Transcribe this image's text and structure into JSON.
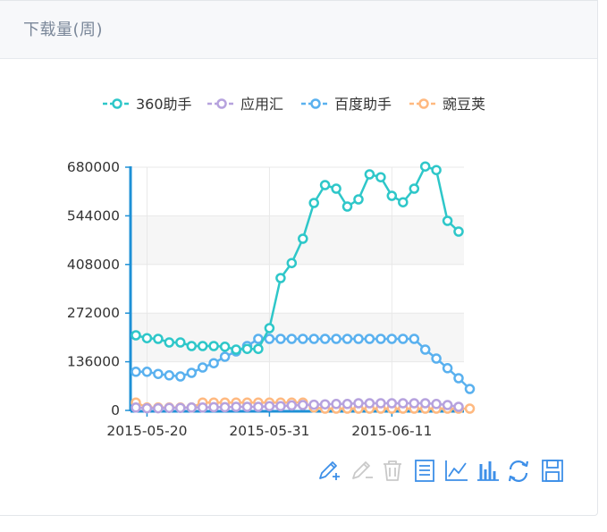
{
  "panel": {
    "title": "下载量(周)"
  },
  "chart_data": {
    "type": "line",
    "title": "",
    "xlabel": "",
    "ylabel": "",
    "ylim": [
      0,
      680000
    ],
    "y_ticks": [
      "0",
      "136000",
      "272000",
      "408000",
      "544000",
      "680000"
    ],
    "x_tick_labels": [
      "2015-05-20",
      "2015-05-31",
      "2015-06-11"
    ],
    "x": [
      "2015-05-19",
      "2015-05-20",
      "2015-05-21",
      "2015-05-22",
      "2015-05-23",
      "2015-05-24",
      "2015-05-25",
      "2015-05-26",
      "2015-05-27",
      "2015-05-28",
      "2015-05-29",
      "2015-05-30",
      "2015-05-31",
      "2015-06-01",
      "2015-06-02",
      "2015-06-03",
      "2015-06-04",
      "2015-06-05",
      "2015-06-06",
      "2015-06-07",
      "2015-06-08",
      "2015-06-09",
      "2015-06-10",
      "2015-06-11",
      "2015-06-12",
      "2015-06-13",
      "2015-06-14",
      "2015-06-15",
      "2015-06-16",
      "2015-06-17",
      "2015-06-18"
    ],
    "grid": true,
    "legend_position": "top-center",
    "series": [
      {
        "name": "360助手",
        "color": "#2ec7c9",
        "values": [
          210000,
          202000,
          200000,
          190000,
          190000,
          180000,
          180000,
          180000,
          178000,
          170000,
          172000,
          172000,
          230000,
          370000,
          412000,
          480000,
          580000,
          630000,
          620000,
          570000,
          590000,
          660000,
          652000,
          600000,
          582000,
          620000,
          682000,
          672000,
          530000,
          500000
        ]
      },
      {
        "name": "应用汇",
        "color": "#b6a2de",
        "values": [
          8000,
          6000,
          6000,
          7000,
          7000,
          8000,
          8000,
          9000,
          9000,
          10000,
          10000,
          10000,
          12000,
          12000,
          14000,
          15000,
          16000,
          17000,
          18000,
          18000,
          20000,
          20000,
          20000,
          20000,
          20000,
          20000,
          20000,
          18000,
          15000,
          10000
        ]
      },
      {
        "name": "百度助手",
        "color": "#5ab1ef",
        "values": [
          108000,
          108000,
          102000,
          98000,
          95000,
          105000,
          120000,
          132000,
          150000,
          165000,
          180000,
          200000,
          200000,
          200000,
          200000,
          200000,
          200000,
          200000,
          200000,
          200000,
          200000,
          200000,
          200000,
          200000,
          200000,
          200000,
          170000,
          145000,
          118000,
          90000,
          60000
        ]
      },
      {
        "name": "豌豆荚",
        "color": "#ffb980",
        "values": [
          22000,
          8000,
          8000,
          8000,
          8000,
          8000,
          22000,
          22000,
          22000,
          22000,
          22000,
          22000,
          22000,
          22000,
          22000,
          22000,
          8000,
          5000,
          5000,
          5000,
          5000,
          5000,
          5000,
          5000,
          5000,
          5000,
          5000,
          5000,
          5000,
          5000,
          5000
        ]
      }
    ]
  },
  "toolbox": {
    "items": [
      {
        "name": "mark",
        "icon": "pen-plus-icon",
        "color": "#3d8fe8"
      },
      {
        "name": "mark-undo",
        "icon": "pen-undo-icon",
        "color": "#c9c9c9"
      },
      {
        "name": "mark-clear",
        "icon": "trash-icon",
        "color": "#c9c9c9"
      },
      {
        "name": "data-view",
        "icon": "document-icon",
        "color": "#3d8fe8"
      },
      {
        "name": "line",
        "icon": "line-chart-icon",
        "color": "#3d8fe8"
      },
      {
        "name": "bar",
        "icon": "bar-chart-icon",
        "color": "#3d8fe8"
      },
      {
        "name": "restore",
        "icon": "refresh-icon",
        "color": "#3d8fe8"
      },
      {
        "name": "save-image",
        "icon": "save-icon",
        "color": "#3d8fe8"
      }
    ]
  }
}
